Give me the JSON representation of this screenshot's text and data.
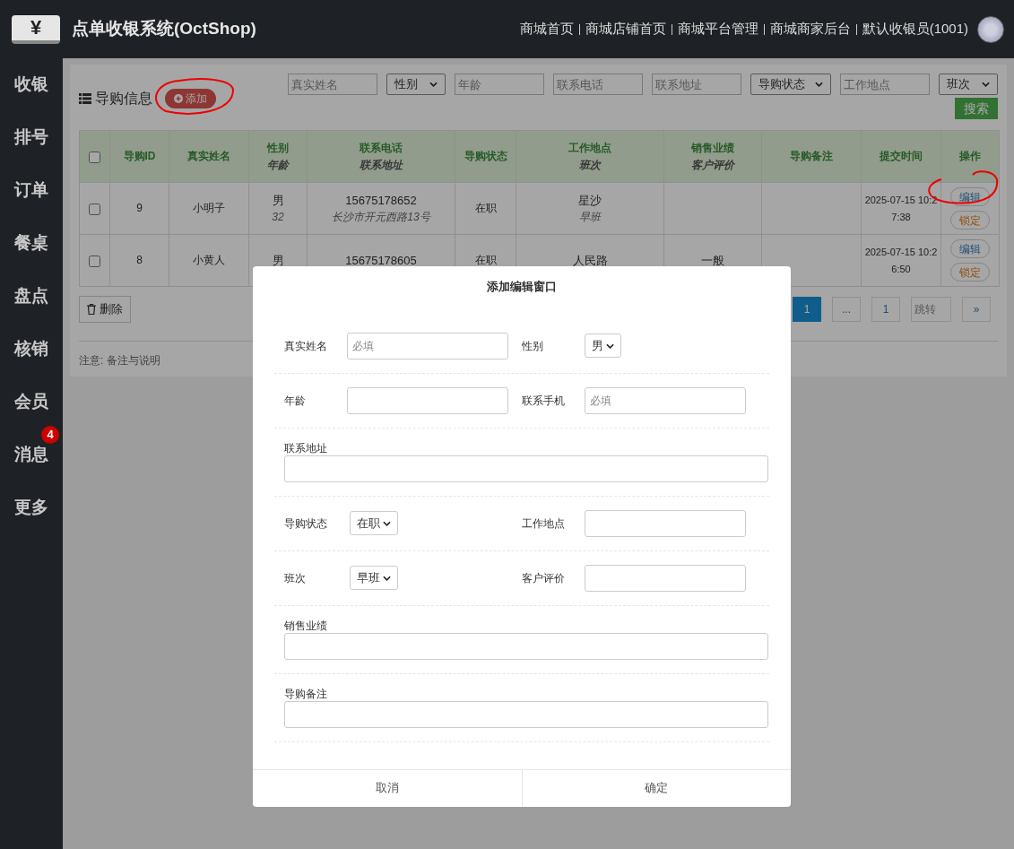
{
  "header": {
    "logo": "¥",
    "title": "点单收银系统(OctShop)",
    "links": [
      "商城首页",
      "商城店铺首页",
      "商城平台管理",
      "商城商家后台",
      "默认收银员(1001)"
    ]
  },
  "sidebar": {
    "items": [
      {
        "label": "收银"
      },
      {
        "label": "排号"
      },
      {
        "label": "订单"
      },
      {
        "label": "餐桌"
      },
      {
        "label": "盘点"
      },
      {
        "label": "核销"
      },
      {
        "label": "会员"
      },
      {
        "label": "消息",
        "badge": "4"
      },
      {
        "label": "更多"
      }
    ]
  },
  "panel": {
    "title": "导购信息",
    "add_button": "添加",
    "filters": [
      {
        "kind": "input",
        "placeholder": "真实姓名"
      },
      {
        "kind": "select",
        "value": "性别"
      },
      {
        "kind": "input",
        "placeholder": "年龄"
      },
      {
        "kind": "input",
        "placeholder": "联系电话"
      },
      {
        "kind": "input",
        "placeholder": "联系地址"
      },
      {
        "kind": "select",
        "value": "导购状态"
      },
      {
        "kind": "input",
        "placeholder": "工作地点"
      },
      {
        "kind": "select",
        "value": "班次"
      }
    ],
    "search_button": "搜索",
    "table": {
      "select_all_checked": false,
      "columns": [
        {
          "label": "导购ID"
        },
        {
          "label": "真实姓名"
        },
        {
          "label": "性别",
          "sub": "年龄"
        },
        {
          "label": "联系电话",
          "sub": "联系地址"
        },
        {
          "label": "导购状态"
        },
        {
          "label": "工作地点",
          "sub": "班次"
        },
        {
          "label": "销售业绩",
          "sub": "客户评价"
        },
        {
          "label": "导购备注"
        },
        {
          "label": "提交时间"
        },
        {
          "label": "操作"
        }
      ],
      "rows": [
        {
          "checked": false,
          "cells": [
            {
              "main": "9"
            },
            {
              "main": "小明子"
            },
            {
              "main": "男",
              "sub": "32"
            },
            {
              "main": "15675178652",
              "sub": "长沙市开元西路13号"
            },
            {
              "main": "在职"
            },
            {
              "main": "星沙",
              "sub": "早班"
            },
            {},
            {},
            {
              "main": "2025-07-15 10:27:38"
            }
          ],
          "actions": [
            {
              "kind": "edit",
              "label": "编辑"
            },
            {
              "kind": "lock",
              "label": "锁定"
            }
          ]
        },
        {
          "checked": false,
          "cells": [
            {
              "main": "8"
            },
            {
              "main": "小黄人"
            },
            {
              "main": "男"
            },
            {
              "main": "15675178605"
            },
            {
              "main": "在职"
            },
            {
              "main": "人民路"
            },
            {
              "main": "一般"
            },
            {},
            {
              "main": "2025-07-15 10:26:50"
            }
          ],
          "actions": [
            {
              "kind": "edit",
              "label": "编辑"
            },
            {
              "kind": "lock",
              "label": "锁定"
            }
          ]
        }
      ]
    },
    "delete_button": "删除",
    "pagination": {
      "pages": [
        {
          "label": "1",
          "selected": true
        },
        {
          "label": "...",
          "selected": false
        },
        {
          "label": "1",
          "selected": false
        }
      ],
      "jump_placeholder": "跳转",
      "next": "»"
    },
    "note": "注意: 备注与说明"
  },
  "modal": {
    "title": "添加编辑窗口",
    "rows": [
      {
        "fields": [
          {
            "label": "真实姓名",
            "kind": "input",
            "placeholder": "必填"
          },
          {
            "label": "性别",
            "kind": "select",
            "value": "男"
          }
        ]
      },
      {
        "fields": [
          {
            "label": "年龄",
            "kind": "input"
          },
          {
            "label": "联系手机",
            "kind": "input",
            "placeholder": "必填"
          }
        ]
      },
      {
        "fields": [
          {
            "label": "联系地址",
            "kind": "input"
          }
        ]
      },
      {
        "fields": [
          {
            "label": "导购状态",
            "kind": "select",
            "value": "在职"
          },
          {
            "label": "工作地点",
            "kind": "input"
          }
        ]
      },
      {
        "fields": [
          {
            "label": "班次",
            "kind": "select",
            "value": "早班"
          },
          {
            "label": "客户评价",
            "kind": "input"
          }
        ]
      },
      {
        "fields": [
          {
            "label": "销售业绩",
            "kind": "input"
          }
        ]
      },
      {
        "fields": [
          {
            "label": "导购备注",
            "kind": "input"
          }
        ]
      }
    ],
    "buttons": [
      "取消",
      "确定"
    ]
  }
}
